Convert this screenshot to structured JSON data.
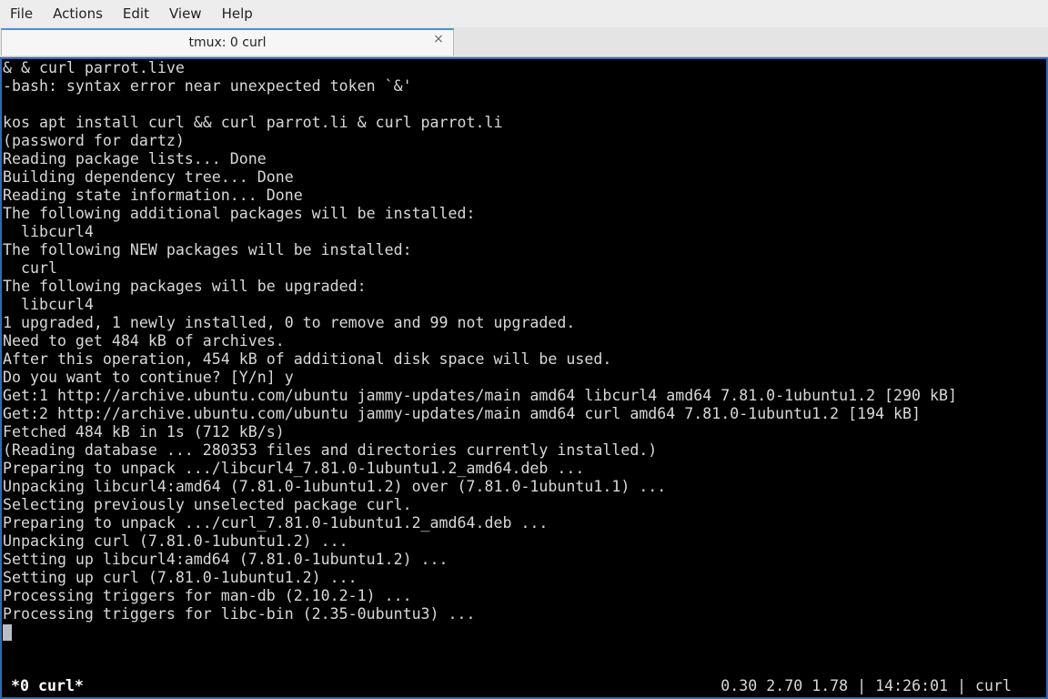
{
  "menubar": {
    "items": [
      "File",
      "Actions",
      "Edit",
      "View",
      "Help"
    ]
  },
  "tab": {
    "title": "tmux: 0 curl",
    "close_glyph": "×"
  },
  "terminal": {
    "lines": [
      "& & curl parrot.live",
      "-bash: syntax error near unexpected token `&'",
      "",
      "kos apt install curl && curl parrot.li & curl parrot.li",
      "(password for dartz)",
      "Reading package lists... Done",
      "Building dependency tree... Done",
      "Reading state information... Done",
      "The following additional packages will be installed:",
      "  libcurl4",
      "The following NEW packages will be installed:",
      "  curl",
      "The following packages will be upgraded:",
      "  libcurl4",
      "1 upgraded, 1 newly installed, 0 to remove and 99 not upgraded.",
      "Need to get 484 kB of archives.",
      "After this operation, 454 kB of additional disk space will be used.",
      "Do you want to continue? [Y/n] y",
      "Get:1 http://archive.ubuntu.com/ubuntu jammy-updates/main amd64 libcurl4 amd64 7.81.0-1ubuntu1.2 [290 kB]",
      "Get:2 http://archive.ubuntu.com/ubuntu jammy-updates/main amd64 curl amd64 7.81.0-1ubuntu1.2 [194 kB]",
      "Fetched 484 kB in 1s (712 kB/s)",
      "(Reading database ... 280353 files and directories currently installed.)",
      "Preparing to unpack .../libcurl4_7.81.0-1ubuntu1.2_amd64.deb ...",
      "Unpacking libcurl4:amd64 (7.81.0-1ubuntu1.2) over (7.81.0-1ubuntu1.1) ...",
      "Selecting previously unselected package curl.",
      "Preparing to unpack .../curl_7.81.0-1ubuntu1.2_amd64.deb ...",
      "Unpacking curl (7.81.0-1ubuntu1.2) ...",
      "Setting up libcurl4:amd64 (7.81.0-1ubuntu1.2) ...",
      "Setting up curl (7.81.0-1ubuntu1.2) ...",
      "Processing triggers for man-db (2.10.2-1) ...",
      "Processing triggers for libc-bin (2.35-0ubuntu3) ..."
    ]
  },
  "statusbar": {
    "window": "*0 curl*",
    "right": "0.30 2.70 1.78 | 14:26:01 | curl"
  },
  "colors": {
    "terminal_bg": "#000000",
    "terminal_fg": "#d8d8d8",
    "focus_border": "#2d6bb8"
  }
}
